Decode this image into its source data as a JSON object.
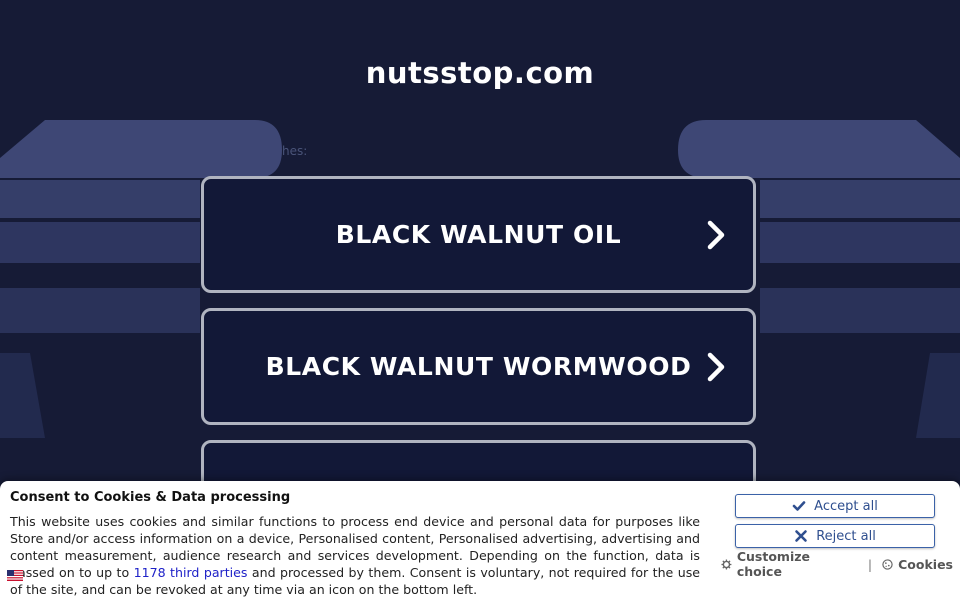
{
  "page": {
    "site_title": "nutsstop.com",
    "related_label": "hes:"
  },
  "search_buttons": [
    {
      "label": "BLACK WALNUT OIL"
    },
    {
      "label": "BLACK WALNUT WORMWOOD"
    },
    {
      "label": ""
    }
  ],
  "consent": {
    "title": "Consent to Cookies & Data processing",
    "text_before_link": "This website uses cookies and similar functions to process end device and personal data for purposes like Store and/or access information on a device, Personalised content, Personalised advertising, advertising and content measurement, audience research and services development. Depending on the function, data is passed on to up to ",
    "link_text": "1178 third parties",
    "text_after_link": " and processed by them. Consent is voluntary, not required for the use of the site, and can be revoked at any time via an icon on the bottom left.",
    "accept_label": "Accept all",
    "reject_label": "Reject all",
    "customize_label": "Customize choice",
    "separator": "|",
    "cookies_label": "Cookies"
  },
  "colors": {
    "background": "#161b36",
    "button_bg": "#121837",
    "button_border": "#b0b4c0",
    "consent_button_text": "#2f4f8f",
    "link": "#1f22c8"
  },
  "icons": {
    "chevron": "chevron-right-icon",
    "accept": "check-icon",
    "reject": "x-icon",
    "customize": "gear-icon",
    "cookies": "cookie-icon",
    "language": "flag-icon"
  }
}
